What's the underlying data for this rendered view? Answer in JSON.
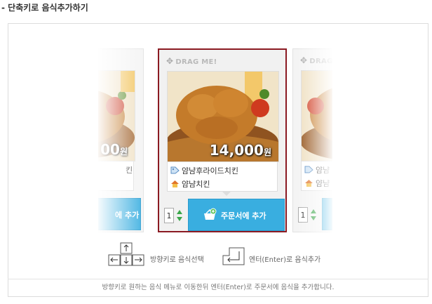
{
  "heading": "- 단축키로 음식추가하기",
  "cards": [
    {
      "drag": "",
      "price": "00",
      "won": "원",
      "name": "킨",
      "store": "",
      "qty": "",
      "button": "에 추가"
    },
    {
      "drag": "DRAG ME!",
      "price": "14,000",
      "won": "원",
      "name": "얌냠후라이드치킨",
      "store": "얌냠치킨",
      "qty": "1",
      "button": "주문서에 추가"
    },
    {
      "drag": "DRAG",
      "price": "",
      "won": "",
      "name": "얌냠",
      "store": "얌냠",
      "qty": "1",
      "button": ""
    }
  ],
  "hints": {
    "arrow_label": "방향키로 음식선택",
    "enter_label": "엔터(Enter)로 음식추가"
  },
  "footer": "방향키로 원하는 음식 메뉴로 이동한뒤 엔터(Enter)로 주문서에 음식을 추가합니다.",
  "colors": {
    "selected_border": "#8b1a22",
    "add_button": "#39aee0"
  },
  "icons": {
    "drag": "move-icon",
    "tag": "tag-icon",
    "store": "house-icon",
    "basket": "basket-plus-icon"
  }
}
